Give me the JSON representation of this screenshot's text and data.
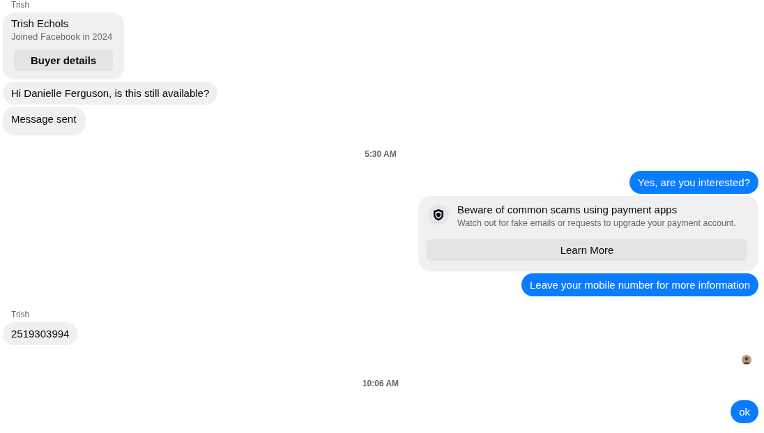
{
  "messages": [
    {
      "kind": "sender_label",
      "text": "Trish"
    },
    {
      "kind": "buyer_card",
      "name": "Trish Echols",
      "subtitle": "Joined Facebook in 2024",
      "button": "Buyer details"
    },
    {
      "kind": "incoming",
      "text": "Hi Danielle Ferguson, is this still available?"
    },
    {
      "kind": "status",
      "text": "Message sent"
    },
    {
      "kind": "timestamp",
      "text": "5:30 AM"
    },
    {
      "kind": "outgoing",
      "text": "Yes, are you interested?"
    },
    {
      "kind": "scam_notice",
      "title": "Beware of common scams using payment apps",
      "body": "Watch out for fake emails or requests to upgrade your payment account.",
      "button": "Learn More"
    },
    {
      "kind": "outgoing",
      "text": "Leave your mobile number for more information"
    },
    {
      "kind": "sender_label",
      "text": "Trish"
    },
    {
      "kind": "incoming",
      "text": "2519303994"
    },
    {
      "kind": "seen_avatar"
    },
    {
      "kind": "timestamp",
      "text": "10:06 AM"
    },
    {
      "kind": "outgoing",
      "text": "ok"
    }
  ]
}
